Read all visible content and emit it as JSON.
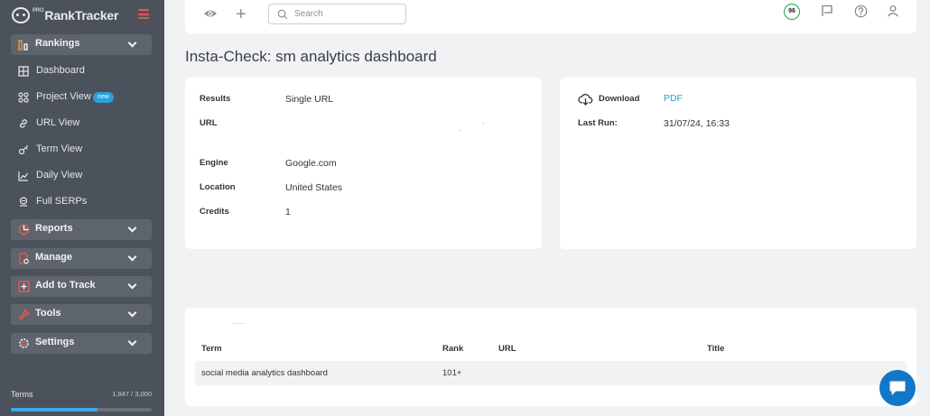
{
  "app": {
    "logo_sup": "PRO",
    "logo_text": "RankTracker"
  },
  "sidebar": {
    "rankings_label": "Rankings",
    "items": [
      {
        "label": "Dashboard",
        "icon": "dashboard-icon"
      },
      {
        "label": "Project View",
        "icon": "project-view-icon",
        "badge": "new"
      },
      {
        "label": "URL View",
        "icon": "link-icon"
      },
      {
        "label": "Term View",
        "icon": "key-icon"
      },
      {
        "label": "Daily View",
        "icon": "line-chart-icon"
      },
      {
        "label": "Full SERPs",
        "icon": "serp-icon"
      }
    ],
    "reports_label": "Reports",
    "manage_label": "Manage",
    "add_to_track_label": "Add to Track",
    "tools_label": "Tools",
    "settings_label": "Settings",
    "terms_label": "Terms",
    "terms_count": "1,847 / 3,000",
    "terms_fraction": 0.6157
  },
  "topbar": {
    "search_placeholder": "Search",
    "score": "96"
  },
  "page": {
    "title": "Insta-Check: sm analytics dashboard"
  },
  "details": {
    "results_label": "Results",
    "results_value": "Single URL",
    "url_label": "URL",
    "url_value": "",
    "engine_label": "Engine",
    "engine_value": "Google.com",
    "location_label": "Location",
    "location_value": "United States",
    "credits_label": "Credits",
    "credits_value": "1"
  },
  "download": {
    "label": "Download",
    "link": "PDF",
    "last_run_label": "Last Run:",
    "last_run_value": "31/07/24, 16:33"
  },
  "table": {
    "headers": {
      "term": "Term",
      "rank": "Rank",
      "url": "URL",
      "title": "Title"
    },
    "rows": [
      {
        "term": "social media analytics dashboard",
        "rank": "101+",
        "url": "",
        "title": ""
      }
    ]
  },
  "colors": {
    "sidebar_bg": "#4b525c",
    "sidebar_group_bg": "#5d646e",
    "accent_red": "#e4574e",
    "link_blue": "#2a9fd8",
    "score_green": "#1ea54a",
    "chat_blue": "#1277c9"
  }
}
